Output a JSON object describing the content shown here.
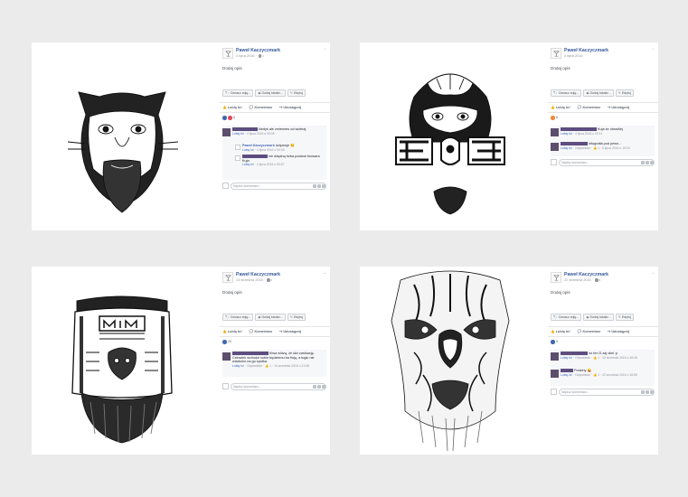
{
  "colors": {
    "brand": "#365899",
    "link": "#4267b2",
    "redacted": "#5e4e80",
    "background": "#ebebeb"
  },
  "cards": [
    {
      "art_kind": "pig-mask-face",
      "author": "Paweł Kaczyczmark",
      "date": "4 lipca 2016 ·",
      "description": "Dodaj opis",
      "tag_buttons": [
        "Oznacz zdję...",
        "Dodaj lokaliz...",
        "Edytuj"
      ],
      "actions": [
        "Lubię to!",
        "Komentarz",
        "Udostępnij"
      ],
      "reaction_count": "6",
      "reaction_color": "#e04b5b",
      "comments": [
        {
          "text": "kiedyś ale zmiennes od wizbraj",
          "meta_like": "Lubię to!",
          "meta_time": "· 4 lipca 2016 o 00:05",
          "replies": [
            {
              "author": "Paweł Kaczyczmark",
              "text": "dzięmuje 😊",
              "meta_like": "Lubię to!",
              "meta_time": "· 4 lipca 2016 o 00:05"
            },
            {
              "text": "nie dżędną trzba podane browara Kuja",
              "meta_like": "Lubię to!",
              "meta_time": "· 4 lipca 2016 o 00:57"
            }
          ]
        }
      ],
      "comment_placeholder": "Napisz komentarz..."
    },
    {
      "art_kind": "symmetric-mask",
      "author": "Paweł Kaczyczmark",
      "date": "4 lipca 2016",
      "description": "Dodaj opis",
      "tag_buttons": [
        "Oznacz zdję...",
        "Dodaj lokaliz...",
        "Edytuj"
      ],
      "actions": [
        "Lubię to!",
        "Komentarz",
        "Udostępnij"
      ],
      "reaction_count": "6",
      "reaction_color": "#f08a3c",
      "comments": [
        {
          "text": "Kuja że obrażliej",
          "meta_like": "Lubię to!",
          "meta_time": "· 4 lipca 2016 o 02:11",
          "replies": []
        },
        {
          "text": "infografia pod pewn...",
          "meta_like": "Lubię to!",
          "meta_time": "· Odpowiedz · 👍 1 · 5 lipca 2016 o 19:16",
          "replies": []
        }
      ],
      "comment_placeholder": "Napisz komentarz..."
    },
    {
      "art_kind": "jar-with-beard",
      "author": "Paweł Kaczyczmark",
      "date": "14 września 2016 ·",
      "description": "Dodaj opis",
      "tag_buttons": [
        "Oznacz zdję...",
        "Dodaj lokaliz...",
        "Edytuj"
      ],
      "actions": [
        "Lubię to!",
        "Komentarz",
        "Udostępnij"
      ],
      "reaction_count": "20",
      "reaction_color": "#4267b2",
      "comments": [
        {
          "text": "Kiwa widzą, że idzi zanikację. Człowiek wchodzi sobie będziemu ba fiują, a tugiu nie wiadomo na go spotka.",
          "meta_like": "Lubię to!",
          "meta_time": "· Odpowiedz · 👍 1 · 14 września 2016 o 21:08",
          "replies": []
        }
      ],
      "comment_placeholder": "Napisz komentarz..."
    },
    {
      "art_kind": "ornamental-mask",
      "author": "Paweł Kaczyczmark",
      "date": "22 września 2016 ·",
      "description": "Dodaj opis",
      "tag_buttons": [
        "Oznacz zdję...",
        "Dodaj lokaliz...",
        "Edytuj"
      ],
      "actions": [
        "Lubię to!",
        "Komentarz",
        "Udostępnij"
      ],
      "reaction_count": "9",
      "reaction_color": "#4267b2",
      "comments": [
        {
          "text": "no ten D zaj oliel :p",
          "meta_like": "Lubię to!",
          "meta_time": "· Odpowiedz · 👍 1 · 22 września 2016 o 16:35",
          "replies": []
        },
        {
          "text": "Podziny 😜",
          "meta_like": "Lubię to!",
          "meta_time": "· Odpowiedz · 👍 1 · 22 września 2016 o 16:55",
          "replies": []
        }
      ],
      "comment_placeholder": "Napisz komentarz..."
    }
  ]
}
